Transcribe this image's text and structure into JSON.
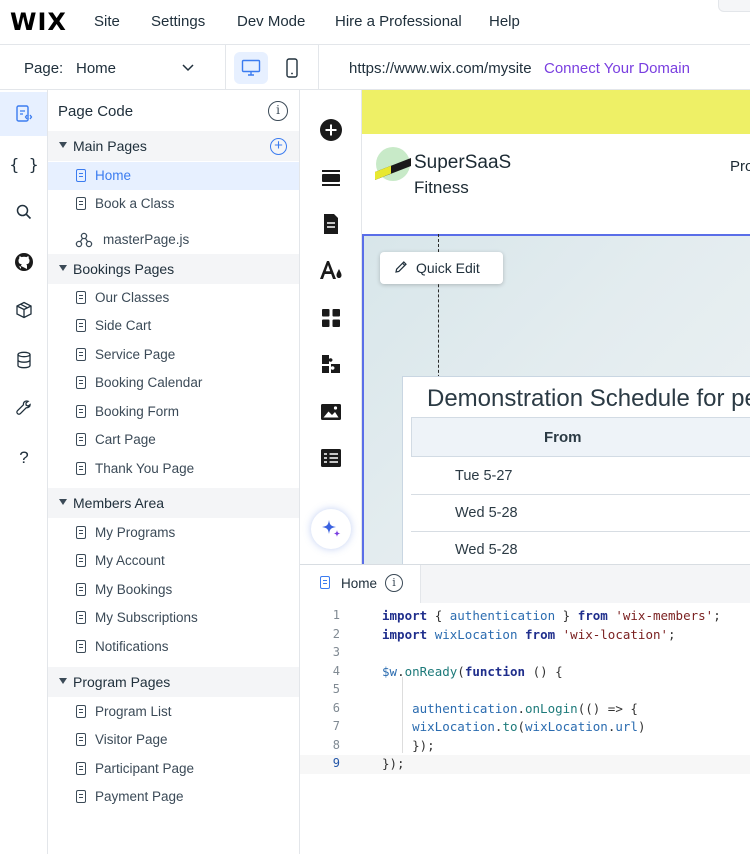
{
  "topbar": {
    "logo": "WIX",
    "menu": [
      "Site",
      "Settings",
      "Dev Mode",
      "Hire a Professional",
      "Help"
    ]
  },
  "pagebar": {
    "page_label": "Page:",
    "page_value": "Home",
    "url": "https://www.wix.com/mysite",
    "connect_domain": "Connect Your Domain"
  },
  "rail_icons": [
    "pages-code-icon",
    "braces-icon",
    "search-icon",
    "github-icon",
    "package-icon",
    "database-icon",
    "wrench-icon",
    "help-icon"
  ],
  "panel": {
    "title": "Page Code",
    "sections": [
      {
        "label": "Main Pages",
        "items": [
          "Home",
          "Book a Class"
        ],
        "special_item": "masterPage.js"
      },
      {
        "label": "Bookings Pages",
        "items": [
          "Our Classes",
          "Side Cart",
          "Service Page",
          "Booking Calendar",
          "Booking Form",
          "Cart Page",
          "Thank You Page"
        ]
      },
      {
        "label": "Members Area",
        "items": [
          "My Programs",
          "My Account",
          "My Bookings",
          "My Subscriptions",
          "Notifications"
        ]
      },
      {
        "label": "Program Pages",
        "items": [
          "Program List",
          "Visitor Page",
          "Participant Page",
          "Payment Page"
        ]
      }
    ]
  },
  "tools": [
    "add-icon",
    "sections-icon",
    "pages-icon",
    "design-icon",
    "apps-icon",
    "business-icon",
    "media-icon",
    "cms-icon",
    "ai-assistant-icon"
  ],
  "canvas": {
    "brand_line1": "SuperSaaS",
    "brand_line2": "Fitness",
    "nav_peek": "Pro",
    "quick_edit": "Quick Edit",
    "schedule_title": "Demonstration Schedule for pe",
    "column_header": "From",
    "rows": [
      "Tue 5-27",
      "Wed 5-28",
      "Wed 5-28"
    ]
  },
  "editor": {
    "tab_label": "Home",
    "line_numbers": [
      "1",
      "2",
      "3",
      "4",
      "5",
      "6",
      "7",
      "8",
      "9"
    ],
    "current_line": "9",
    "code_lines": [
      "import { authentication } from 'wix-members';",
      "import wixLocation from 'wix-location';",
      "",
      "$w.onReady(function () {",
      "",
      "    authentication.onLogin(() => {",
      "    wixLocation.to(wixLocation.url)",
      "    });",
      "});"
    ]
  },
  "colors": {
    "accent": "#3b7cf0",
    "link": "#7a3fe0",
    "header_strip": "#eef066",
    "selection_border": "#5a6ee8"
  }
}
